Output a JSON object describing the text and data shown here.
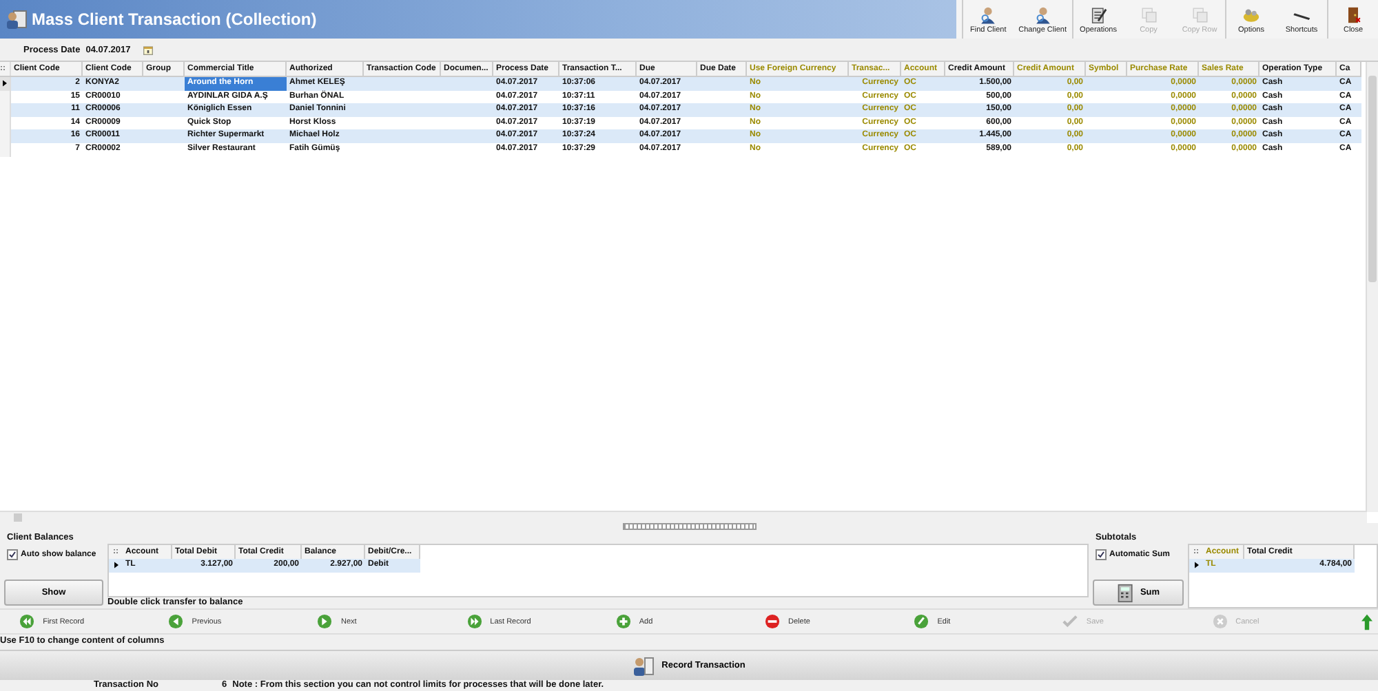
{
  "window": {
    "title": "Mass Client Transaction (Collection)"
  },
  "toolbar": [
    {
      "kind": "find",
      "label": "Find Client",
      "disabled": false,
      "group_start": true
    },
    {
      "kind": "change",
      "label": "Change Client",
      "disabled": false,
      "group_start": false
    },
    {
      "kind": "operations",
      "label": "Operations",
      "disabled": false,
      "group_start": true
    },
    {
      "kind": "copy",
      "label": "Copy",
      "disabled": true,
      "group_start": false
    },
    {
      "kind": "copy",
      "label": "Copy Row",
      "disabled": true,
      "group_start": false
    },
    {
      "kind": "options",
      "label": "Options",
      "disabled": false,
      "group_start": true
    },
    {
      "kind": "shortcuts",
      "label": "Shortcuts",
      "disabled": false,
      "group_start": false
    },
    {
      "kind": "close",
      "label": "Close",
      "disabled": false,
      "group_start": true
    }
  ],
  "process_date": {
    "label": "Process Date",
    "value": "04.07.2017"
  },
  "table": {
    "corner": "::",
    "columns": [
      {
        "label": "Client Code",
        "kind": "number",
        "readonly": false,
        "focused": false
      },
      {
        "label": "Client Code",
        "kind": "text",
        "readonly": false,
        "focused": false
      },
      {
        "label": "Group",
        "kind": "text",
        "readonly": false,
        "focused": false
      },
      {
        "label": "Commercial Title",
        "kind": "text",
        "readonly": false,
        "focused": true
      },
      {
        "label": "Authorized",
        "kind": "text",
        "readonly": false,
        "focused": false
      },
      {
        "label": "Transaction Code",
        "kind": "text",
        "readonly": false,
        "focused": false
      },
      {
        "label": "Documen...",
        "kind": "text",
        "readonly": false,
        "focused": false
      },
      {
        "label": "Process Date",
        "kind": "text",
        "readonly": false,
        "focused": false
      },
      {
        "label": "Transaction T...",
        "kind": "text",
        "readonly": false,
        "focused": false
      },
      {
        "label": "Due",
        "kind": "text",
        "readonly": false,
        "focused": false
      },
      {
        "label": "Due Date",
        "kind": "text",
        "readonly": false,
        "focused": false
      },
      {
        "label": "Use Foreign Currency",
        "kind": "text",
        "readonly": true,
        "focused": false
      },
      {
        "label": "Transac...",
        "kind": "number",
        "readonly": true,
        "focused": false
      },
      {
        "label": "Account",
        "kind": "text",
        "readonly": true,
        "focused": false
      },
      {
        "label": "Credit Amount",
        "kind": "number",
        "readonly": false,
        "focused": false
      },
      {
        "label": "Credit Amount",
        "kind": "number",
        "readonly": true,
        "focused": false
      },
      {
        "label": "Symbol",
        "kind": "text",
        "readonly": true,
        "focused": false
      },
      {
        "label": "Purchase Rate",
        "kind": "number",
        "readonly": true,
        "focused": false
      },
      {
        "label": "Sales Rate",
        "kind": "number",
        "readonly": true,
        "focused": false
      },
      {
        "label": "Operation Type",
        "kind": "text",
        "readonly": false,
        "focused": false
      },
      {
        "label": "Ca",
        "kind": "text",
        "readonly": false,
        "focused": false
      }
    ],
    "rows": [
      {
        "selected": true,
        "cells": [
          "2",
          "KONYA2",
          "",
          "Around the Horn",
          "Ahmet KELEŞ",
          "",
          "",
          "04.07.2017",
          "10:37:06",
          "04.07.2017",
          "",
          "No",
          "Currency",
          "OC",
          "1.500,00",
          "0,00",
          "",
          "0,0000",
          "0,0000",
          "Cash",
          "CA"
        ]
      },
      {
        "selected": false,
        "cells": [
          "15",
          "CR00010",
          "",
          "AYDINLAR GIDA A.Ş",
          "Burhan ÖNAL",
          "",
          "",
          "04.07.2017",
          "10:37:11",
          "04.07.2017",
          "",
          "No",
          "Currency",
          "OC",
          "500,00",
          "0,00",
          "",
          "0,0000",
          "0,0000",
          "Cash",
          "CA"
        ]
      },
      {
        "selected": false,
        "cells": [
          "11",
          "CR00006",
          "",
          "Königlich Essen",
          "Daniel  Tonnini",
          "",
          "",
          "04.07.2017",
          "10:37:16",
          "04.07.2017",
          "",
          "No",
          "Currency",
          "OC",
          "150,00",
          "0,00",
          "",
          "0,0000",
          "0,0000",
          "Cash",
          "CA"
        ]
      },
      {
        "selected": false,
        "cells": [
          "14",
          "CR00009",
          "",
          "Quick Stop",
          "Horst Kloss",
          "",
          "",
          "04.07.2017",
          "10:37:19",
          "04.07.2017",
          "",
          "No",
          "Currency",
          "OC",
          "600,00",
          "0,00",
          "",
          "0,0000",
          "0,0000",
          "Cash",
          "CA"
        ]
      },
      {
        "selected": false,
        "cells": [
          "16",
          "CR00011",
          "",
          "Richter Supermarkt",
          "Michael Holz",
          "",
          "",
          "04.07.2017",
          "10:37:24",
          "04.07.2017",
          "",
          "No",
          "Currency",
          "OC",
          "1.445,00",
          "0,00",
          "",
          "0,0000",
          "0,0000",
          "Cash",
          "CA"
        ]
      },
      {
        "selected": false,
        "cells": [
          "7",
          "CR00002",
          "",
          "Silver Restaurant",
          "Fatih Gümüş",
          "",
          "",
          "04.07.2017",
          "10:37:29",
          "04.07.2017",
          "",
          "No",
          "Currency",
          "OC",
          "589,00",
          "0,00",
          "",
          "0,0000",
          "0,0000",
          "Cash",
          "CA"
        ]
      }
    ]
  },
  "client_balances": {
    "title": "Client Balances",
    "auto_show": {
      "label": "Auto show balance",
      "checked": true
    },
    "show_button": "Show",
    "table": {
      "corner": "::",
      "columns": [
        {
          "label": "Account",
          "kind": "text",
          "readonly": false
        },
        {
          "label": "Total Debit",
          "kind": "number",
          "readonly": false
        },
        {
          "label": "Total Credit",
          "kind": "number",
          "readonly": false
        },
        {
          "label": "Balance",
          "kind": "number",
          "readonly": false
        },
        {
          "label": "Debit/Cre...",
          "kind": "text",
          "readonly": false
        }
      ],
      "rows": [
        {
          "selected": true,
          "cells": [
            "TL",
            "3.127,00",
            "200,00",
            "2.927,00",
            "Debit"
          ]
        }
      ]
    },
    "hint": "Double click transfer to balance"
  },
  "subtotals": {
    "title": "Subtotals",
    "automatic_sum": {
      "label": "Automatic Sum",
      "checked": true
    },
    "sum_button": "Sum",
    "table": {
      "corner": "::",
      "columns": [
        {
          "label": "Account",
          "kind": "text",
          "readonly": true
        },
        {
          "label": "Total Credit",
          "kind": "number",
          "readonly": false
        }
      ],
      "rows": [
        {
          "selected": true,
          "cells": [
            "TL",
            "4.784,00"
          ]
        }
      ]
    }
  },
  "navigator": [
    {
      "kind": "first",
      "label": "First Record",
      "disabled": false
    },
    {
      "kind": "prev",
      "label": "Previous",
      "disabled": false
    },
    {
      "kind": "next",
      "label": "Next",
      "disabled": false
    },
    {
      "kind": "last",
      "label": "Last Record",
      "disabled": false
    },
    {
      "kind": "add",
      "label": "Add",
      "disabled": false
    },
    {
      "kind": "delete",
      "label": "Delete",
      "disabled": false
    },
    {
      "kind": "edit",
      "label": "Edit",
      "disabled": false
    },
    {
      "kind": "save",
      "label": "Save",
      "disabled": true
    },
    {
      "kind": "cancel",
      "label": "Cancel",
      "disabled": true
    }
  ],
  "f10_hint": "Use F10 to change content of columns",
  "record_button": "Record Transaction",
  "status": {
    "label": "Transaction No",
    "number": "6",
    "note": "Note : From this section you can not control limits for processes that will be done later."
  }
}
